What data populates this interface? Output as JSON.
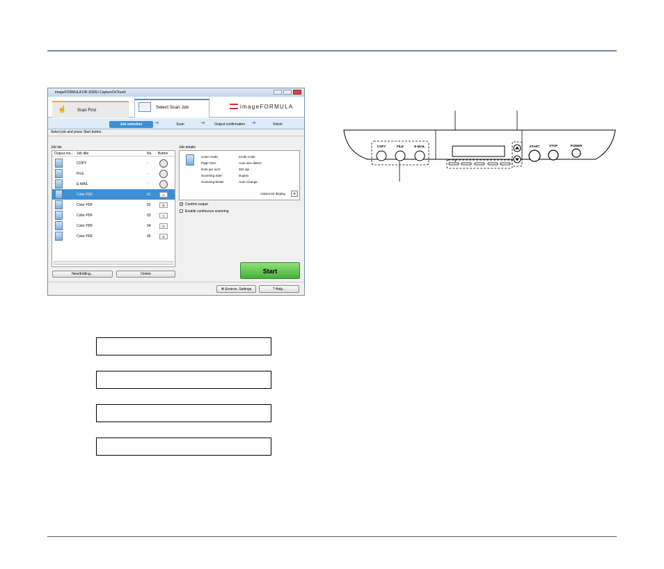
{
  "window": {
    "title": "imageFORMULA DR-2020U CaptureOnTouch",
    "tab_scan_first": "Scan First",
    "tab_select_job": "Select Scan Job",
    "logo": "imageFORMULA"
  },
  "steps": [
    "Job selection",
    "Scan",
    "Output confirmation",
    "Finish"
  ],
  "instruction": "Select job and press Start button.",
  "job_list": {
    "label": "Job list",
    "headers": [
      "Output me...",
      "Job title",
      "No.",
      "Button"
    ],
    "rows": [
      {
        "title": "COPY",
        "no": "-",
        "button": ""
      },
      {
        "title": "FILE",
        "no": "-",
        "button": ""
      },
      {
        "title": "E-MAIL",
        "no": "-",
        "button": ""
      },
      {
        "title": "Color PDF",
        "no": "01",
        "button": "A"
      },
      {
        "title": "Color PDF",
        "no": "02",
        "button": "B"
      },
      {
        "title": "Color PDF",
        "no": "03",
        "button": "C"
      },
      {
        "title": "Color PDF",
        "no": "04",
        "button": "D"
      },
      {
        "title": "Color PDF",
        "no": "05",
        "button": "E"
      }
    ],
    "selected_index": 3
  },
  "buttons": {
    "new_editing": "New/Editing...",
    "delete": "Delete",
    "start": "Start",
    "environ_settings": "Environ. Settings",
    "help": "Help..."
  },
  "job_details": {
    "label": "Job details",
    "rows": [
      {
        "k": "Color mode:",
        "v": "24-bit Color"
      },
      {
        "k": "Page Size:",
        "v": "Auto size detect"
      },
      {
        "k": "Dots per inch:",
        "v": "200 dpi"
      },
      {
        "k": "Scanning Side:",
        "v": "Duplex"
      },
      {
        "k": "Scanning Mode:",
        "v": "Auto Change"
      }
    ],
    "advanced": "Advanced display"
  },
  "checks": {
    "confirm_output": "Confirm output",
    "continuous": "Enable continuous scanning",
    "confirm_checked": true,
    "continuous_checked": false
  },
  "panel": {
    "copy": "COPY",
    "file": "FILE",
    "email": "E-MAIL",
    "start": "START",
    "stop": "STOP",
    "power": "POWER"
  },
  "blank_boxes": [
    "",
    "",
    "",
    ""
  ],
  "colors": {
    "accent": "#3f8fd6",
    "header_rule": "#6f86b8",
    "start_green": "#45b03a"
  }
}
